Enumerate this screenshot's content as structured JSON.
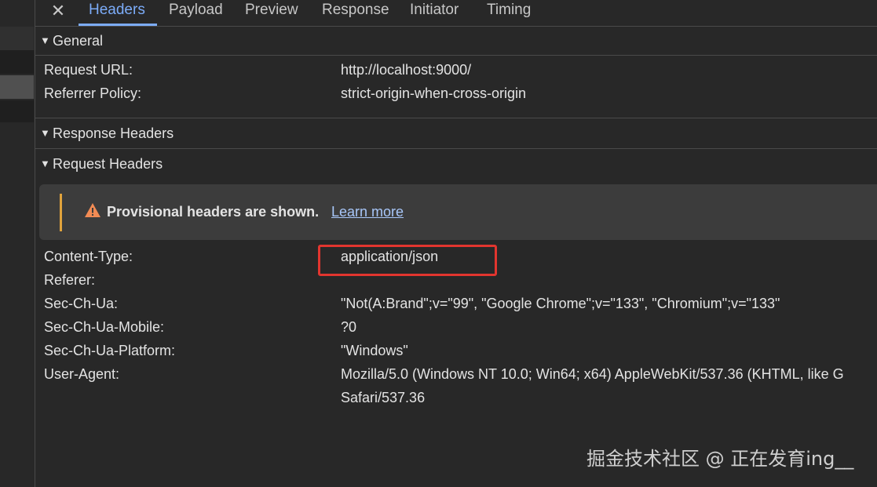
{
  "tabs": {
    "close_label": "✕",
    "items": [
      "Headers",
      "Payload",
      "Preview",
      "Response",
      "Initiator",
      "Timing"
    ],
    "active": "Headers"
  },
  "general": {
    "title": "General",
    "rows": [
      {
        "key": "Request URL:",
        "value": "http://localhost:9000/"
      },
      {
        "key": "Referrer Policy:",
        "value": "strict-origin-when-cross-origin"
      }
    ]
  },
  "response_headers": {
    "title": "Response Headers"
  },
  "request_headers": {
    "title": "Request Headers",
    "warning": {
      "icon": "warning-triangle-icon",
      "message": "Provisional headers are shown.",
      "link": "Learn more"
    },
    "rows": [
      {
        "key": "Content-Type:",
        "value": "application/json"
      },
      {
        "key": "Referer:",
        "value": ""
      },
      {
        "key": "Sec-Ch-Ua:",
        "value": "\"Not(A:Brand\";v=\"99\", \"Google Chrome\";v=\"133\", \"Chromium\";v=\"133\""
      },
      {
        "key": "Sec-Ch-Ua-Mobile:",
        "value": "?0"
      },
      {
        "key": "Sec-Ch-Ua-Platform:",
        "value": "\"Windows\""
      },
      {
        "key": "User-Agent:",
        "value": "Mozilla/5.0 (Windows NT 10.0; Win64; x64) AppleWebKit/537.36 (KHTML, like G"
      },
      {
        "key": "",
        "value": "Safari/537.36"
      }
    ]
  },
  "watermark": "掘金技术社区 @ 正在发育ing__",
  "colors": {
    "background": "#282828",
    "active_tab": "#7cacf8",
    "warning_bar": "#e0a33c",
    "highlight_box": "#e2352f",
    "link": "#a8c7fa"
  }
}
